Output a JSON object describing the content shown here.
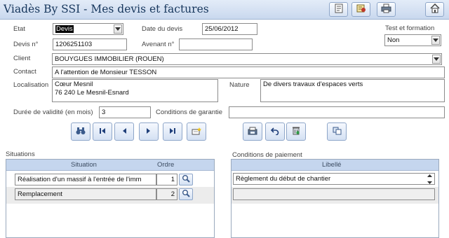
{
  "app": {
    "title": "Viadès By SSI - Mes devis et factures"
  },
  "toolbar": {
    "icons": [
      "report-icon",
      "tools-icon",
      "print-icon",
      "home-icon"
    ]
  },
  "form": {
    "etat": {
      "label": "Etat",
      "value": "Devis"
    },
    "date": {
      "label": "Date du devis",
      "value": "25/06/2012"
    },
    "test": {
      "label": "Test et formation",
      "value": "Non"
    },
    "devis": {
      "label": "Devis n°",
      "value": "1206251103"
    },
    "avenant": {
      "label": "Avenant n°",
      "value": ""
    },
    "client": {
      "label": "Client",
      "value": "BOUYGUES IMMOBILIER (ROUEN)"
    },
    "contact": {
      "label": "Contact",
      "value": "A l'attention de Monsieur TESSON"
    },
    "localisation": {
      "label": "Localisation",
      "line1": "Cœur Mesnil",
      "line2": "76 240  Le Mesnil-Esnard"
    },
    "nature": {
      "label": "Nature",
      "value": "De divers travaux d'espaces verts"
    },
    "duree": {
      "label": "Durée de validité (en mois)",
      "value": "3"
    },
    "garantie": {
      "label": "Conditions de garantie",
      "value": ""
    }
  },
  "navigation": {
    "buttons": [
      "binoculars-icon",
      "first-record-icon",
      "previous-record-icon",
      "next-record-icon",
      "last-record-icon",
      "new-record-icon",
      "save-icon",
      "undo-icon",
      "delete-icon",
      "copy-icon"
    ]
  },
  "situations": {
    "section_label": "Situations",
    "columns": [
      "Situation",
      "Ordre"
    ],
    "rows": [
      {
        "situation": "Réalisation d'un massif à l'entrée de l'imm",
        "ordre": "1"
      },
      {
        "situation": "Remplacement",
        "ordre": "2"
      }
    ]
  },
  "paiement": {
    "section_label": "Conditions de paiement",
    "columns": [
      "Libellé"
    ],
    "rows": [
      {
        "libelle": "Règlement du début de chantier"
      },
      {
        "libelle": ""
      }
    ]
  }
}
